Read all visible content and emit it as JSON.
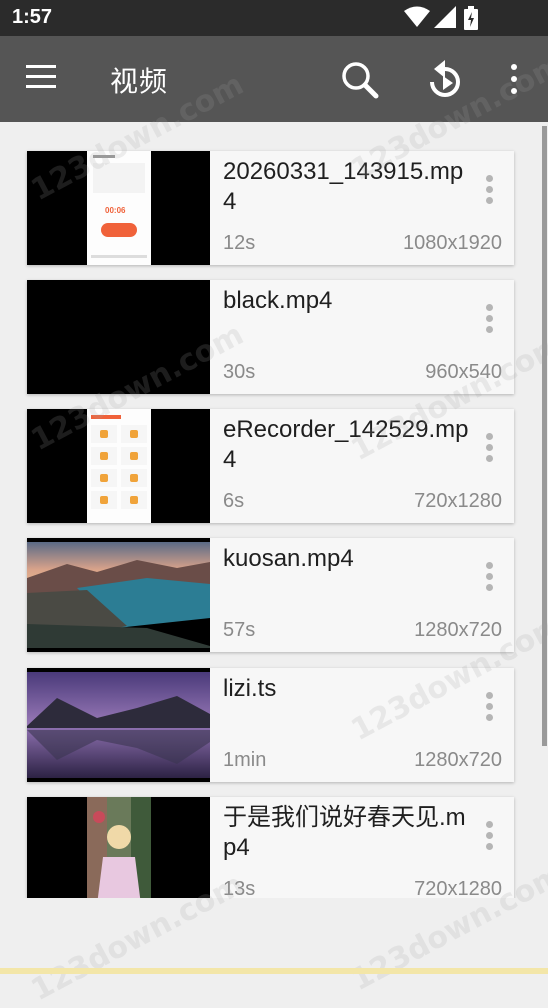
{
  "status_bar": {
    "time": "1:57"
  },
  "app_bar": {
    "title": "视频",
    "icons": [
      "menu-icon",
      "search-icon",
      "replay-icon",
      "more-vert-icon"
    ]
  },
  "videos": [
    {
      "name": "20260331_143915.mp4",
      "duration": "12s",
      "resolution": "1080x1920",
      "thumb": "app-screenshot-timer"
    },
    {
      "name": "black.mp4",
      "duration": "30s",
      "resolution": "960x540",
      "thumb": "black"
    },
    {
      "name": "eRecorder_142529.mp4",
      "duration": "6s",
      "resolution": "720x1280",
      "thumb": "app-screenshot-grid"
    },
    {
      "name": "kuosan.mp4",
      "duration": "57s",
      "resolution": "1280x720",
      "thumb": "fjord-landscape"
    },
    {
      "name": "lizi.ts",
      "duration": "1min",
      "resolution": "1280x720",
      "thumb": "purple-lake-landscape"
    },
    {
      "name": "于是我们说好春天见.mp4",
      "duration": "13s",
      "resolution": "720x1280",
      "thumb": "girl-portrait"
    }
  ],
  "watermark": "123down.com",
  "colors": {
    "app_bar": "#555555",
    "status_bar": "#2b2b2b",
    "accent": "#f0623a"
  }
}
